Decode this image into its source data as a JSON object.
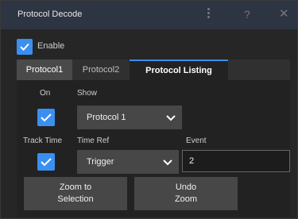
{
  "window": {
    "title": "Protocol Decode"
  },
  "enable": {
    "label": "Enable",
    "checked": true
  },
  "tabs": [
    {
      "label": "Protocol1"
    },
    {
      "label": "Protocol2"
    },
    {
      "label": "Protocol Listing"
    }
  ],
  "listing": {
    "on_label": "On",
    "on_checked": true,
    "show_label": "Show",
    "show_value": "Protocol 1",
    "track_time_label": "Track Time",
    "track_time_checked": true,
    "time_ref_label": "Time Ref",
    "time_ref_value": "Trigger",
    "event_label": "Event",
    "event_value": "2"
  },
  "buttons": {
    "zoom_line1": "Zoom to",
    "zoom_line2": "Selection",
    "undo_line1": "Undo",
    "undo_line2": "Zoom"
  },
  "colors": {
    "accent": "#3a8ff0",
    "titlebar": "#2d3442",
    "background": "#262626"
  },
  "icons": [
    "kebab-menu-icon",
    "help-icon",
    "close-icon",
    "checkmark-icon",
    "chevron-down-icon"
  ]
}
